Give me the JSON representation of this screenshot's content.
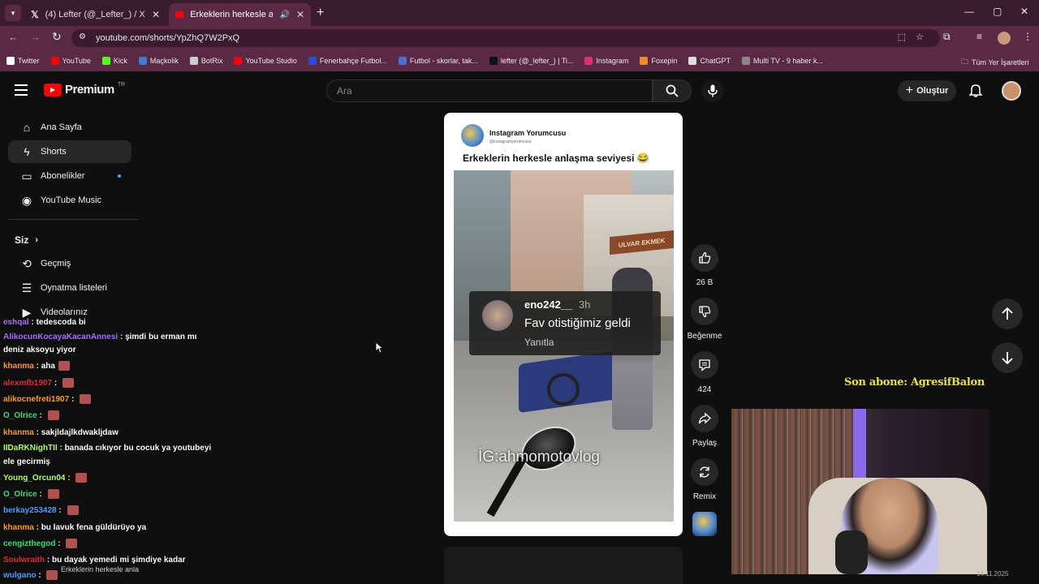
{
  "tabs": [
    {
      "label": "(4) Lefter (@_Lefter_) / X",
      "favicon": "x-icon"
    },
    {
      "label": "Erkeklerin herkesle anlaşma",
      "favicon": "youtube-icon"
    }
  ],
  "url": "youtube.com/shorts/YpZhQ7W2PxQ",
  "bookmarks": [
    {
      "label": "Twitter",
      "color": "#ffffff"
    },
    {
      "label": "YouTube",
      "color": "#ff0000"
    },
    {
      "label": "Kick",
      "color": "#53fc18"
    },
    {
      "label": "Maçkolik",
      "color": "#3a7bd5"
    },
    {
      "label": "BotRix",
      "color": "#cccccc"
    },
    {
      "label": "YouTube Studio",
      "color": "#ff0000"
    },
    {
      "label": "Fenerbahçe Futbol...",
      "color": "#2a4bd8"
    },
    {
      "label": "Futbol - skorlar, tak...",
      "color": "#4a6fd8"
    },
    {
      "label": "lefter (@_lefter_) | Ti...",
      "color": "#111111"
    },
    {
      "label": "Instagram",
      "color": "#e1306c"
    },
    {
      "label": "Foxepin",
      "color": "#f08a24"
    },
    {
      "label": "ChatGPT",
      "color": "#dddddd"
    },
    {
      "label": "Multi TV - 9 haber k...",
      "color": "#888888"
    }
  ],
  "bookmarks_all": "Tüm Yer İşaretleri",
  "brand": {
    "name": "Premium",
    "region": "TR"
  },
  "search": {
    "placeholder": "Ara"
  },
  "create_label": "Oluştur",
  "sidebar": {
    "items": [
      {
        "label": "Ana Sayfa",
        "icon": "home-icon"
      },
      {
        "label": "Shorts",
        "icon": "shorts-icon"
      },
      {
        "label": "Abonelikler",
        "icon": "subscriptions-icon"
      },
      {
        "label": "YouTube Music",
        "icon": "music-icon"
      }
    ],
    "section": "Siz",
    "you_items": [
      {
        "label": "Geçmiş",
        "icon": "history-icon"
      },
      {
        "label": "Oynatma listeleri",
        "icon": "playlist-icon"
      },
      {
        "label": "Videolarınız",
        "icon": "videos-icon"
      }
    ]
  },
  "chat": [
    {
      "user": "eshqal",
      "color": "#b070ff",
      "msg": "tedescoda bi",
      "emote": false
    },
    {
      "user": "AlikocunKocayaKacanAnnesi",
      "color": "#b070ff",
      "msg": "şimdi bu erman mı",
      "emote": false
    },
    {
      "user": "",
      "color": "#ffffff",
      "msg": "deniz aksoyu yiyor",
      "emote": false
    },
    {
      "user": "khanma",
      "color": "#ff9f1a",
      "msg": "aha",
      "emote": true
    },
    {
      "user": "alexmfb1907",
      "color": "#e0303a",
      "msg": "",
      "emote": true
    },
    {
      "user": "alikocnefreti1907",
      "color": "#ff9f1a",
      "msg": "",
      "emote": true
    },
    {
      "user": "O_Olrice",
      "color": "#3ae07a",
      "msg": "",
      "emote": true
    },
    {
      "user": "khanma",
      "color": "#ff9f1a",
      "msg": "sakjldajlkdwakljdaw",
      "emote": false
    },
    {
      "user": "IIDaRKNighTII",
      "color": "#b0ff60",
      "msg": "banada cıkıyor bu cocuk ya youtubeyi",
      "emote": false
    },
    {
      "user": "",
      "color": "#ffffff",
      "msg": "ele gecirmiş",
      "emote": false
    },
    {
      "user": "Young_Orcun04",
      "color": "#b0ff60",
      "msg": "",
      "emote": true
    },
    {
      "user": "O_Olrice",
      "color": "#3ae07a",
      "msg": "",
      "emote": true
    },
    {
      "user": "berkay253428",
      "color": "#4aa0ff",
      "msg": "",
      "emote": true
    },
    {
      "user": "khanma",
      "color": "#ff9f1a",
      "msg": "bu lavuk fena güldürüyo ya",
      "emote": false
    },
    {
      "user": "cengizthegod",
      "color": "#3ae07a",
      "msg": "",
      "emote": true
    },
    {
      "user": "Soulwraith",
      "color": "#e0303a",
      "msg": "bu dayak yemedi mi şimdiye kadar",
      "emote": false
    },
    {
      "user": "wulgano",
      "color": "#4aa0ff",
      "msg": "",
      "emote": true
    }
  ],
  "short": {
    "channel": "Instagram Yorumcusu",
    "handle": "@instagramyorumcusu",
    "title": "Erkeklerin herkesle anlaşma seviyesi 😂",
    "comment_user": "eno242__",
    "comment_time": "3h",
    "comment_text": "Fav otistiğimiz geldi",
    "comment_reply": "Yanıtla",
    "watermark": "İG:ahmomotovlog",
    "sign": "ULVAR EKMEK"
  },
  "actions": {
    "likes": "26 B",
    "dislike": "Beğenme",
    "comments": "424",
    "share": "Paylaş",
    "remix": "Remix"
  },
  "overlay": {
    "last_sub": "Son abone: AgresifBalon",
    "bottom_text": "Erkeklerin herkesle anla",
    "date": "14.11.2025"
  }
}
